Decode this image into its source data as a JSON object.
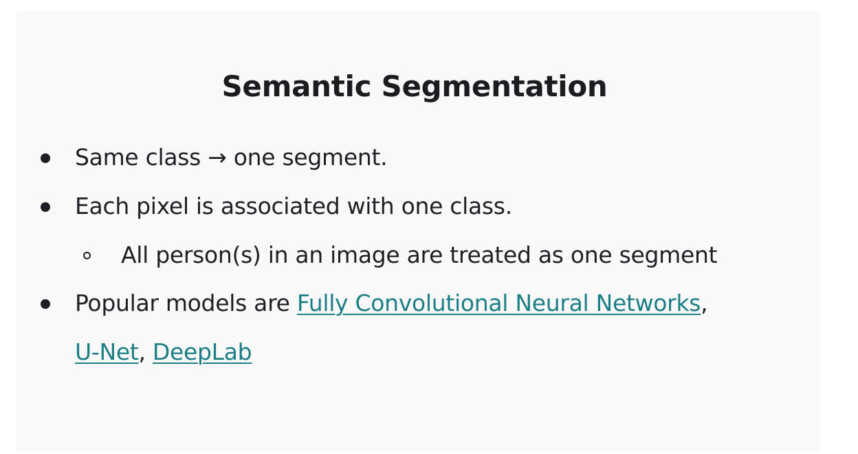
{
  "slide": {
    "title": "Semantic Segmentation",
    "bullets": [
      {
        "text": "Same class → one segment."
      },
      {
        "text": "Each pixel is associated with one class."
      },
      {
        "text": "All person(s) in an image are treated as one segment"
      },
      {
        "prefix": "Popular models are ",
        "links": [
          "Fully Convolutional Neural Networks",
          "U-Net",
          "DeepLab"
        ],
        "separator": ","
      }
    ]
  },
  "colors": {
    "background": "#f9f9fa",
    "text": "#1d1f24",
    "link": "#1b7e84"
  }
}
